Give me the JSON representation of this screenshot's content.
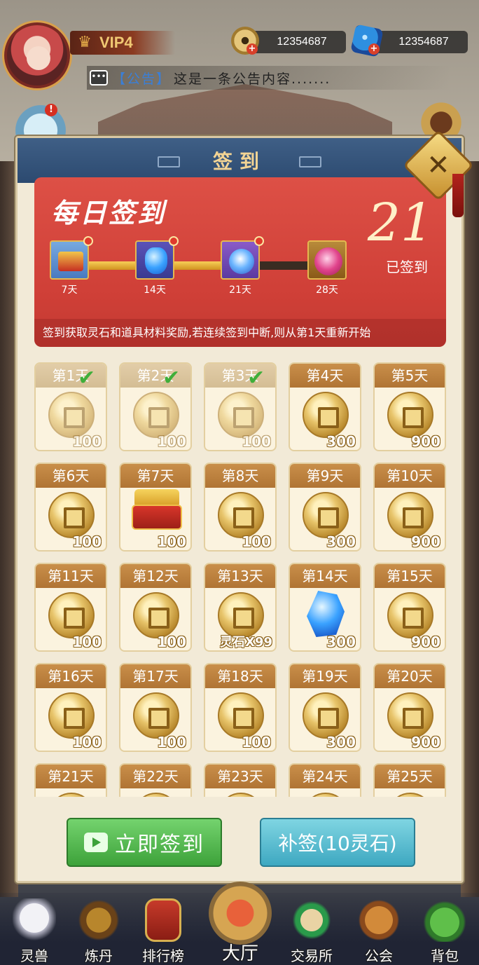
{
  "topbar": {
    "vip_label": "VIP4",
    "coins": "12354687",
    "gems": "12354687",
    "notice_tag": "【公告】",
    "notice_text": "这是一条公告内容......."
  },
  "dialog": {
    "title": "签到",
    "close_label": "✕",
    "banner": {
      "title": "每日签到",
      "streak_count": "21",
      "streak_label": "已签到",
      "progress_fraction": 0.67,
      "milestones": [
        {
          "label": "7天",
          "icon": "chest-icon",
          "has_dot": true
        },
        {
          "label": "14天",
          "icon": "blue-gem-icon",
          "has_dot": true
        },
        {
          "label": "21天",
          "icon": "spirit-orb-icon",
          "has_dot": true
        },
        {
          "label": "28天",
          "icon": "pink-orb-icon",
          "has_dot": false
        }
      ],
      "description": "签到获取灵石和道具材料奖励,若连续签到中断,则从第1天重新开始"
    },
    "days": [
      {
        "label": "第1天",
        "value": "100",
        "reward": "coin",
        "signed": true
      },
      {
        "label": "第2天",
        "value": "100",
        "reward": "coin",
        "signed": true
      },
      {
        "label": "第3天",
        "value": "100",
        "reward": "coin",
        "signed": true
      },
      {
        "label": "第4天",
        "value": "300",
        "reward": "coin",
        "signed": false
      },
      {
        "label": "第5天",
        "value": "900",
        "reward": "coin",
        "signed": false
      },
      {
        "label": "第6天",
        "value": "100",
        "reward": "coin",
        "signed": false
      },
      {
        "label": "第7天",
        "value": "100",
        "reward": "chest",
        "signed": false
      },
      {
        "label": "第8天",
        "value": "100",
        "reward": "coin",
        "signed": false
      },
      {
        "label": "第9天",
        "value": "300",
        "reward": "coin",
        "signed": false
      },
      {
        "label": "第10天",
        "value": "900",
        "reward": "coin",
        "signed": false
      },
      {
        "label": "第11天",
        "value": "100",
        "reward": "coin",
        "signed": false
      },
      {
        "label": "第12天",
        "value": "100",
        "reward": "coin",
        "signed": false
      },
      {
        "label": "第13天",
        "value": "灵石X99",
        "reward": "coin",
        "signed": false
      },
      {
        "label": "第14天",
        "value": "300",
        "reward": "gem",
        "signed": false
      },
      {
        "label": "第15天",
        "value": "900",
        "reward": "coin",
        "signed": false
      },
      {
        "label": "第16天",
        "value": "100",
        "reward": "coin",
        "signed": false
      },
      {
        "label": "第17天",
        "value": "100",
        "reward": "coin",
        "signed": false
      },
      {
        "label": "第18天",
        "value": "100",
        "reward": "coin",
        "signed": false
      },
      {
        "label": "第19天",
        "value": "300",
        "reward": "coin",
        "signed": false
      },
      {
        "label": "第20天",
        "value": "900",
        "reward": "coin",
        "signed": false
      },
      {
        "label": "第21天",
        "value": "",
        "reward": "coin",
        "signed": false
      },
      {
        "label": "第22天",
        "value": "",
        "reward": "coin",
        "signed": false
      },
      {
        "label": "第23天",
        "value": "",
        "reward": "coin",
        "signed": false
      },
      {
        "label": "第24天",
        "value": "",
        "reward": "coin",
        "signed": false
      },
      {
        "label": "第25天",
        "value": "",
        "reward": "coin",
        "signed": false
      }
    ],
    "sign_button": "立即签到",
    "resign_button": "补签(10灵石)"
  },
  "nav": {
    "items": [
      {
        "label": "灵兽",
        "icon": "spirit-beast-icon"
      },
      {
        "label": "炼丹",
        "icon": "furnace-icon"
      },
      {
        "label": "排行榜",
        "icon": "rank-banner-icon"
      },
      {
        "label": "交易所",
        "icon": "trade-scroll-icon"
      },
      {
        "label": "公会",
        "icon": "guild-icon"
      },
      {
        "label": "背包",
        "icon": "bag-icon"
      }
    ],
    "center_label": "大厅"
  },
  "colors": {
    "banner_red": "#dd5046",
    "header_blue": "#3f5f86",
    "sign_green": "#3da23a",
    "resign_cyan": "#3ea8c1",
    "cell_gold": "#c98f4a"
  }
}
